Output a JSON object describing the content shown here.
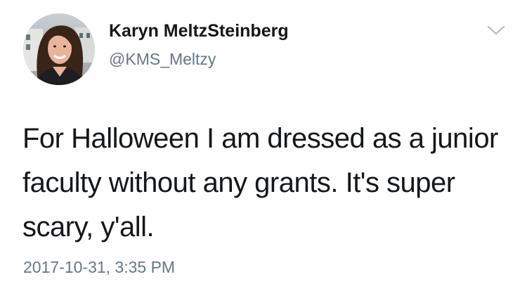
{
  "user": {
    "display_name": "Karyn MeltzSteinberg",
    "handle": "@KMS_Meltzy"
  },
  "tweet": {
    "text": "For Halloween I am dressed as a junior faculty without any grants. It's super scary, y'all.",
    "timestamp": "2017-10-31, 3:35 PM"
  },
  "icons": {
    "avatar": "profile-photo",
    "menu": "chevron-down-icon"
  },
  "colors": {
    "text": "#14171a",
    "secondary": "#657786"
  }
}
